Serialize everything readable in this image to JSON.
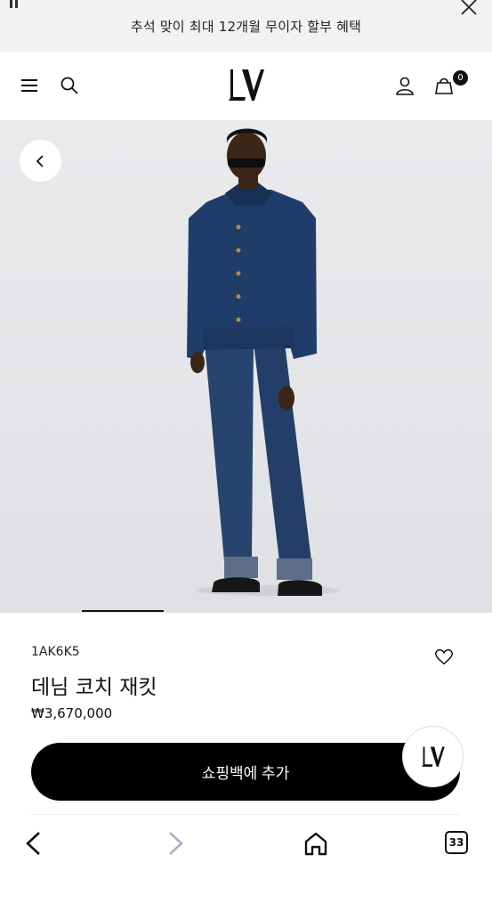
{
  "promo_banner": {
    "text": "추석 맞이 최대 12개월 무이자 할부 혜택"
  },
  "header": {
    "cart_count": "0"
  },
  "product": {
    "reference": "1AK6K5",
    "name": "데님 코치 재킷",
    "price": "₩3,670,000",
    "carousel": {
      "active_slide": 1
    }
  },
  "actions": {
    "add_to_bag_label": "쇼핑백에 추가"
  },
  "browser": {
    "tab_count": "33"
  },
  "colors": {
    "accent": "#000000",
    "hero_bg": "#e6e7ea",
    "denim": "#1f3a66"
  }
}
